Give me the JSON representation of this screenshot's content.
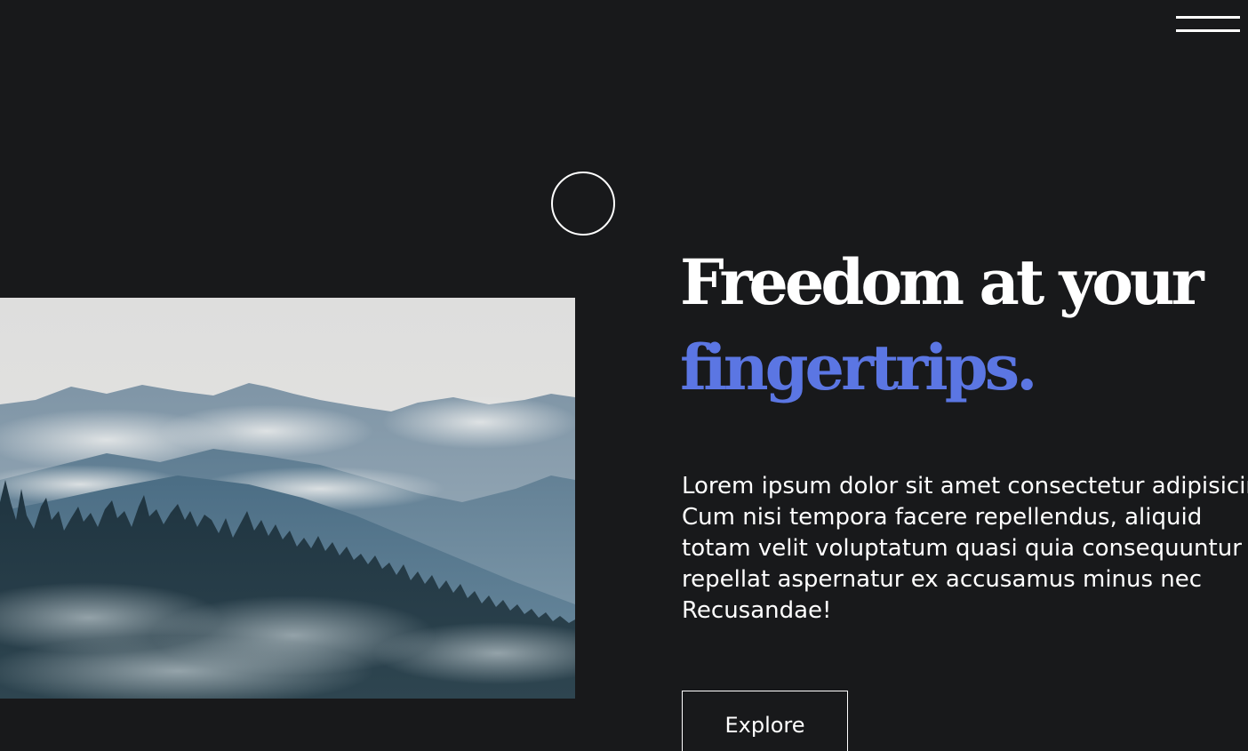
{
  "nav": {
    "menu_icon": "hamburger-menu-icon"
  },
  "cursor": {
    "icon": "circle-cursor-icon"
  },
  "hero": {
    "image_alt": "Misty mountains with pine forest",
    "headline_line1": "Freedom at your",
    "headline_line2": "fingertrips.",
    "paragraph_lines": [
      "Lorem ipsum dolor sit amet consectetur adipisicing elit.",
      "Cum nisi tempora facere repellendus, aliquid",
      "totam velit voluptatum quasi quia consequuntur",
      "repellat aspernatur ex accusamus minus nec",
      "Recusandae!"
    ],
    "button_label": "Explore"
  },
  "colors": {
    "background": "#18191b",
    "text": "#ffffff",
    "accent": "#5b76e3"
  }
}
